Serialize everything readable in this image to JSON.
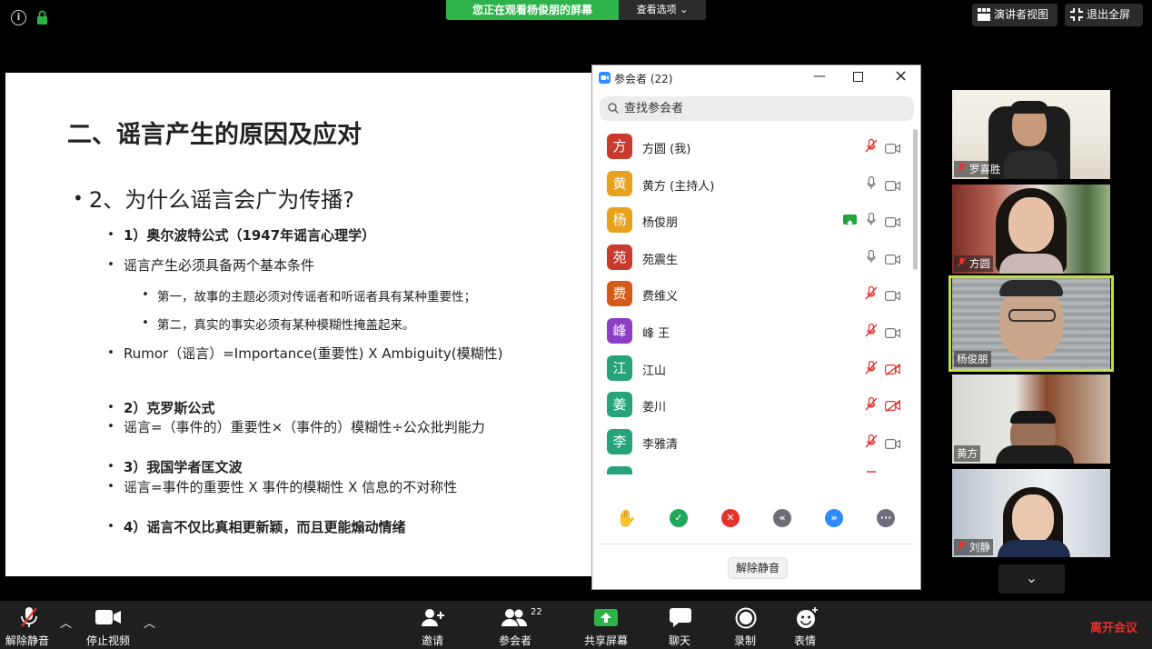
{
  "top_bar": {
    "share_banner": "您正在观看杨俊朋的屏幕",
    "view_options": "查看选项",
    "speaker_view": "演讲者视图",
    "exit_fullscreen": "退出全屏"
  },
  "slide": {
    "title": "二、谣言产生的原因及应对",
    "question": "2、为什么谣言会广为传播?",
    "l1": "1）奥尔波特公式（1947年谣言心理学）",
    "l2": "谣言产生必须具备两个基本条件",
    "l3": "第一，故事的主题必须对传谣者和听谣者具有某种重要性；",
    "l4": "第二，真实的事实必须有某种模糊性掩盖起来。",
    "l5": "Rumor（谣言）=Importance(重要性)  X  Ambiguity(模糊性)",
    "l6": "2）克罗斯公式",
    "l7": "谣言=（事件的）重要性×（事件的）模糊性÷公众批判能力",
    "l8": "3）我国学者匡文波",
    "l9": "谣言=事件的重要性 X 事件的模糊性 X 信息的不对称性",
    "l10": "4）谣言不仅比真相更新颖，而且更能煽动情绪"
  },
  "panel": {
    "title": "参会者 (22)",
    "search_placeholder": "查找参会者",
    "participants": [
      {
        "initial": "方",
        "name": "方圆 (我)",
        "color": "#c8392e",
        "mic": "muted",
        "cam": "on"
      },
      {
        "initial": "黄",
        "name": "黄方 (主持人)",
        "color": "#e8a11c",
        "mic": "on",
        "cam": "on"
      },
      {
        "initial": "杨",
        "name": "杨俊朋",
        "color": "#e8a11c",
        "mic": "on",
        "cam": "on",
        "sharing": true
      },
      {
        "initial": "苑",
        "name": "苑震生",
        "color": "#c8392e",
        "mic": "on",
        "cam": "on"
      },
      {
        "initial": "费",
        "name": "费维义",
        "color": "#d65a17",
        "mic": "muted",
        "cam": "on"
      },
      {
        "initial": "峰",
        "name": "峰 王",
        "color": "#8a3fc4",
        "mic": "muted",
        "cam": "on"
      },
      {
        "initial": "江",
        "name": "江山",
        "color": "#27a37c",
        "mic": "muted",
        "cam": "off"
      },
      {
        "initial": "姜",
        "name": "姜川",
        "color": "#27a37c",
        "mic": "muted",
        "cam": "off"
      },
      {
        "initial": "李",
        "name": "李雅清",
        "color": "#27a37c",
        "mic": "muted",
        "cam": "on"
      }
    ],
    "unmute_label": "解除静音"
  },
  "tiles": [
    {
      "name": "罗喜胜",
      "muted": true
    },
    {
      "name": "方圆",
      "muted": true
    },
    {
      "name": "杨俊朋",
      "muted": false
    },
    {
      "name": "黄方",
      "muted": false
    },
    {
      "name": "刘静",
      "muted": true
    }
  ],
  "toolbar": {
    "unmute": "解除静音",
    "stop_video": "停止视频",
    "invite": "邀请",
    "participants": "参会者",
    "participants_count": "22",
    "share_screen": "共享屏幕",
    "chat": "聊天",
    "record": "录制",
    "reactions": "表情",
    "leave": "离开会议"
  },
  "colors": {
    "accent_green": "#2eb34a",
    "leave_red": "#e5322d",
    "active_speaker": "#c4e03a"
  }
}
